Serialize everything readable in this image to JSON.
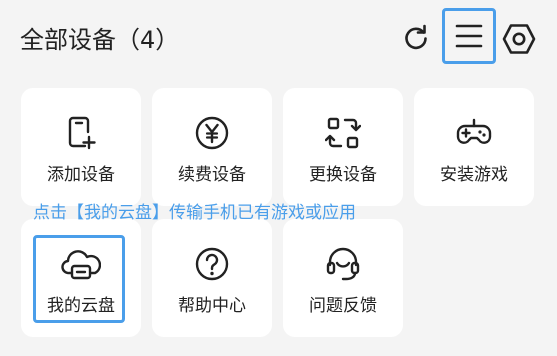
{
  "header": {
    "title": "全部设备（4）"
  },
  "icons": {
    "refresh": "refresh-icon",
    "menu": "menu-icon",
    "settings": "hexagon-settings-icon"
  },
  "colors": {
    "accent": "#4a9eea",
    "background": "#f4f4f4",
    "tile": "#ffffff",
    "text": "#222222"
  },
  "tiles": [
    {
      "label": "添加设备",
      "icon": "add-device-icon"
    },
    {
      "label": "续费设备",
      "icon": "yen-icon"
    },
    {
      "label": "更换设备",
      "icon": "swap-icon"
    },
    {
      "label": "安装游戏",
      "icon": "gamepad-icon"
    },
    {
      "label": "我的云盘",
      "icon": "cloud-drive-icon",
      "selected": true
    },
    {
      "label": "帮助中心",
      "icon": "help-icon"
    },
    {
      "label": "问题反馈",
      "icon": "headset-icon"
    }
  ],
  "tip": "点击【我的云盘】传输手机已有游戏或应用"
}
